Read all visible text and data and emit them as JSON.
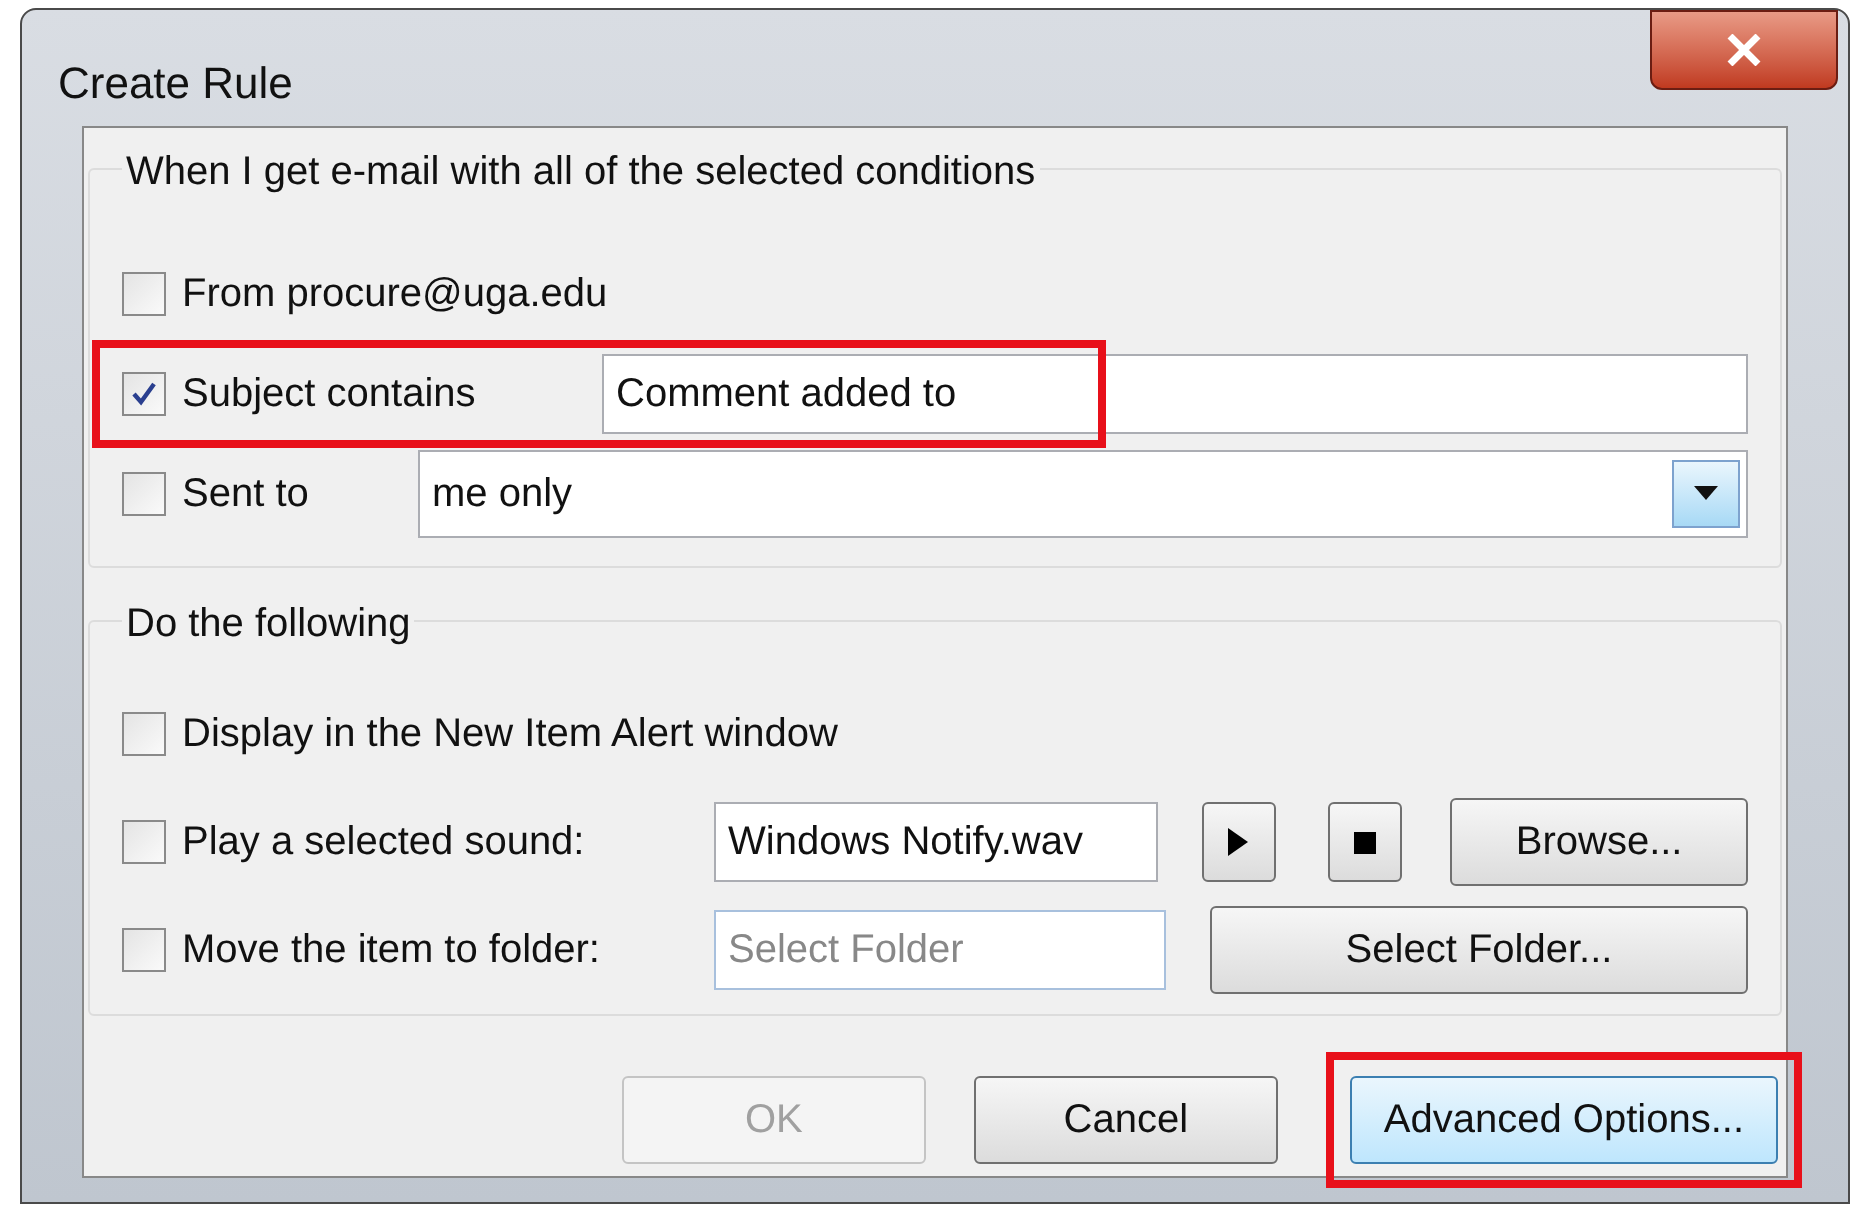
{
  "window": {
    "title": "Create Rule"
  },
  "conditions": {
    "legend": "When I get e-mail with all of the selected conditions",
    "items": [
      {
        "kind": "plain",
        "label": "From procure@uga.edu",
        "checked": false
      },
      {
        "kind": "text",
        "label": "Subject contains",
        "value": "Comment added to",
        "checked": true,
        "highlighted": true
      },
      {
        "kind": "dropdown",
        "label": "Sent to",
        "value": "me only",
        "checked": false
      }
    ]
  },
  "actions": {
    "legend": "Do the following",
    "items": [
      {
        "kind": "plain",
        "label": "Display in the New Item Alert window",
        "checked": false
      },
      {
        "kind": "sound",
        "label": "Play a selected sound:",
        "value": "Windows Notify.wav",
        "button": "Browse...",
        "checked": false
      },
      {
        "kind": "folder",
        "label": "Move the item to folder:",
        "placeholder": "Select Folder",
        "button": "Select Folder...",
        "checked": false
      }
    ]
  },
  "buttons": [
    {
      "label": "OK",
      "disabled": true,
      "highlighted": false
    },
    {
      "label": "Cancel",
      "disabled": false,
      "highlighted": false
    },
    {
      "label": "Advanced Options...",
      "disabled": false,
      "highlighted": true
    }
  ]
}
